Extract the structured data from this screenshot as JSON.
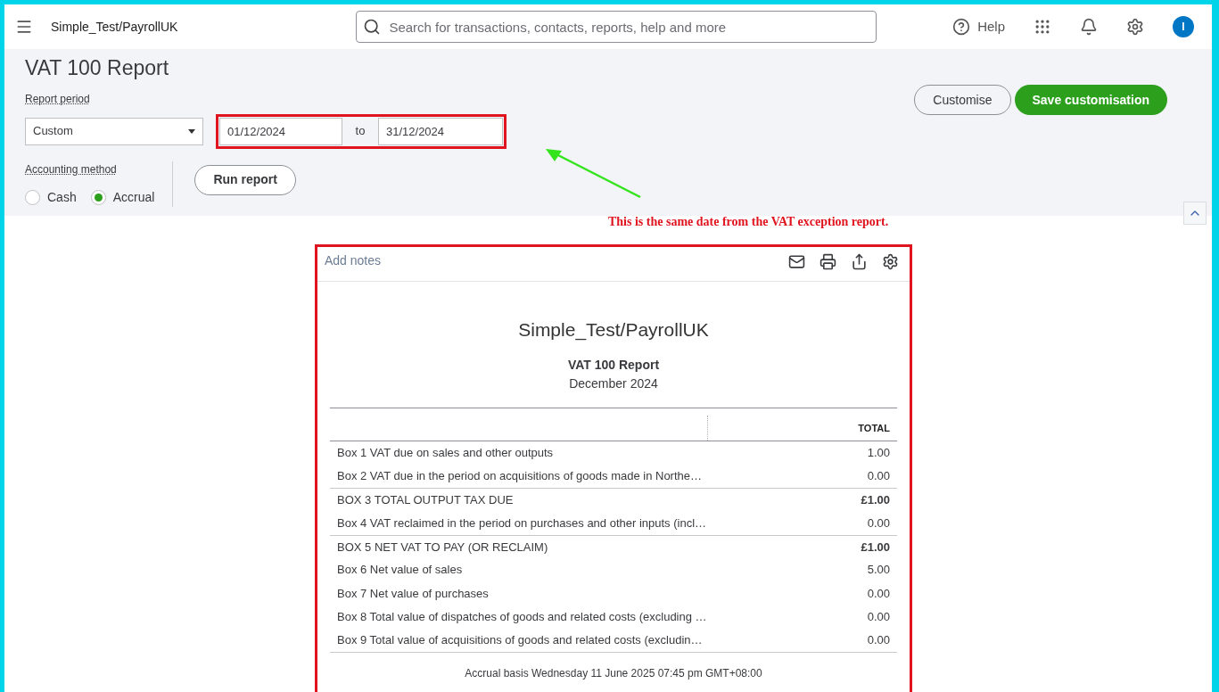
{
  "topbar": {
    "company": "Simple_Test/PayrollUK",
    "search_placeholder": "Search for transactions, contacts, reports, help and more",
    "help": "Help",
    "avatar": "I"
  },
  "page": {
    "title": "VAT 100 Report",
    "report_period_label": "Report period",
    "period": "Custom",
    "from": "01/12/2024",
    "to_label": "to",
    "to": "31/12/2024",
    "accounting_method_label": "Accounting method",
    "methods": [
      {
        "label": "Cash",
        "selected": false
      },
      {
        "label": "Accrual",
        "selected": true
      }
    ],
    "run_report": "Run report",
    "customise": "Customise",
    "save_customisation": "Save customisation"
  },
  "annotation": {
    "text": "This is the same date from the VAT exception report."
  },
  "report": {
    "add_notes": "Add notes",
    "company": "Simple_Test/PayrollUK",
    "title": "VAT 100 Report",
    "period": "December 2024",
    "column": "TOTAL",
    "rows": [
      {
        "kind": "line",
        "label": "Box 1 VAT due on sales and other outputs",
        "value": "1.00"
      },
      {
        "kind": "line",
        "label": "Box 2 VAT due in the period on acquisitions of goods made in Northe…",
        "value": "0.00"
      },
      {
        "kind": "total",
        "label": "BOX 3 TOTAL OUTPUT TAX DUE",
        "value": "£1.00"
      },
      {
        "kind": "line",
        "label": "Box 4 VAT reclaimed in the period on purchases and other inputs (incl…",
        "value": "0.00"
      },
      {
        "kind": "total",
        "label": "BOX 5 NET VAT TO PAY (OR RECLAIM)",
        "value": "£1.00"
      },
      {
        "kind": "line",
        "label": "Box 6 Net value of sales",
        "value": "5.00"
      },
      {
        "kind": "line",
        "label": "Box 7 Net value of purchases",
        "value": "0.00"
      },
      {
        "kind": "line",
        "label": "Box 8 Total value of dispatches of goods and related costs (excluding …",
        "value": "0.00"
      },
      {
        "kind": "line",
        "label": "Box 9 Total value of acquisitions of goods and related costs (excludin…",
        "value": "0.00"
      }
    ],
    "footer": "Accrual basis  Wednesday 11 June 2025  07:45 pm GMT+08:00"
  }
}
